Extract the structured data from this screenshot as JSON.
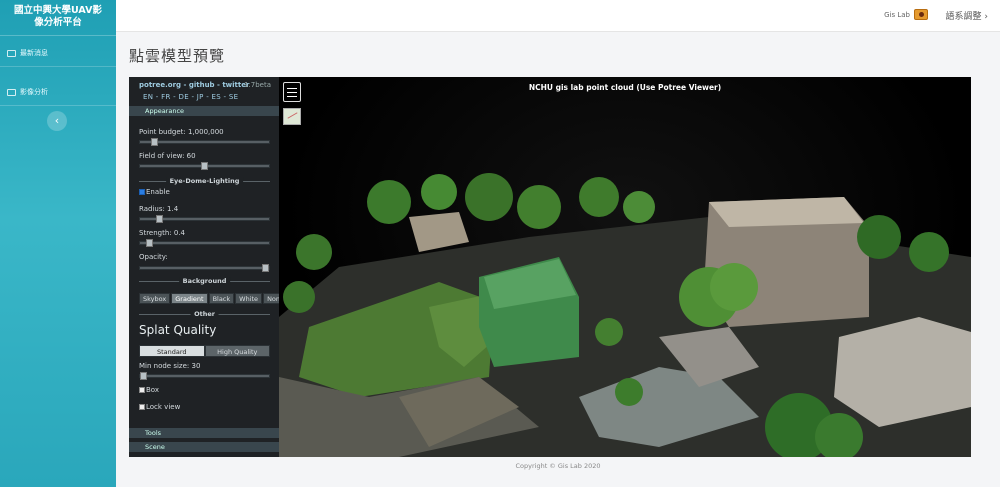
{
  "sidebar": {
    "brand": [
      "國立中興大學UAV影",
      "像分析平台"
    ],
    "items": [
      {
        "label": "最新消息",
        "icon": "news-icon"
      },
      {
        "label": "影像分析",
        "icon": "image-analysis-icon"
      }
    ],
    "collapse_icon": "‹"
  },
  "topbar": {
    "user_name": "Gis Lab",
    "language_link": "語系調整 ›"
  },
  "page": {
    "title": "點雲模型預覽"
  },
  "viewer": {
    "scene_title": "NCHU gis lab point cloud (Use Potree Viewer)",
    "panel": {
      "links": "potree.org - github - twitter",
      "version": "1.7beta",
      "languages": "EN - FR - DE - JP - ES - SE",
      "appearance": "Appearance",
      "point_budget_label": "Point budget: 1,000,000",
      "fov_label": "Field of view: 60",
      "edl_header": "Eye-Dome-Lighting",
      "edl_enable": "Enable",
      "radius_label": "Radius: 1.4",
      "strength_label": "Strength: 0.4",
      "opacity_label": "Opacity:",
      "background_header": "Background",
      "background_options": [
        "Skybox",
        "Gradient",
        "Black",
        "White",
        "None"
      ],
      "background_selected": "Gradient",
      "other_header": "Other",
      "splat_title": "Splat Quality",
      "quality_options": [
        "Standard",
        "High Quality"
      ],
      "quality_selected": "Standard",
      "min_node_label": "Min node size: 30",
      "box_label": "Box",
      "lock_view_label": "Lock view",
      "tools_header": "Tools",
      "scene_header": "Scene"
    },
    "slider_levels": {
      "point_budget": 0.09,
      "field_of_view": 0.5,
      "radius": 0.13,
      "strength": 0.05,
      "opacity": 1.0,
      "min_node_size": 0.0
    }
  },
  "footer": {
    "copyright": "Copyright © Gis Lab 2020"
  },
  "colors": {
    "sidebar_accent": "#2aa7bb",
    "panel_bg": "#1f2225",
    "link_blue": "#9ecbe0"
  }
}
